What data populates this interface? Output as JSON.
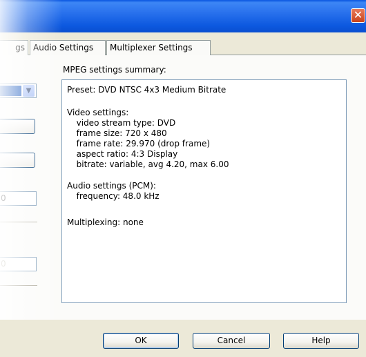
{
  "window": {
    "close_symbol": "✕"
  },
  "tabs": [
    {
      "label": "gs"
    },
    {
      "label": "Audio Settings"
    },
    {
      "label": "Multiplexer Settings"
    }
  ],
  "summary": {
    "label": "MPEG settings summary:",
    "lines": [
      "Preset: DVD NTSC 4x3 Medium Bitrate",
      "",
      "Video settings:",
      "  video stream type: DVD",
      "  frame size: 720 x 480",
      "  frame rate: 29.970 (drop frame)",
      "  aspect ratio: 4:3 Display",
      "  bitrate: variable, avg 4.20, max 6.00",
      "",
      "Audio settings (PCM):",
      "  frequency: 48.0 kHz",
      "",
      "Multiplexing: none"
    ]
  },
  "left_controls": {
    "field1_value": "0",
    "field2_value": "0"
  },
  "buttons": {
    "ok": "OK",
    "cancel": "Cancel",
    "help": "Help"
  },
  "icons": {
    "close": "close-icon",
    "dropdown": "chevron-down-icon"
  },
  "colors": {
    "titlebar": "#0c58df",
    "selection": "#316ac5",
    "border": "#7f9db9"
  }
}
